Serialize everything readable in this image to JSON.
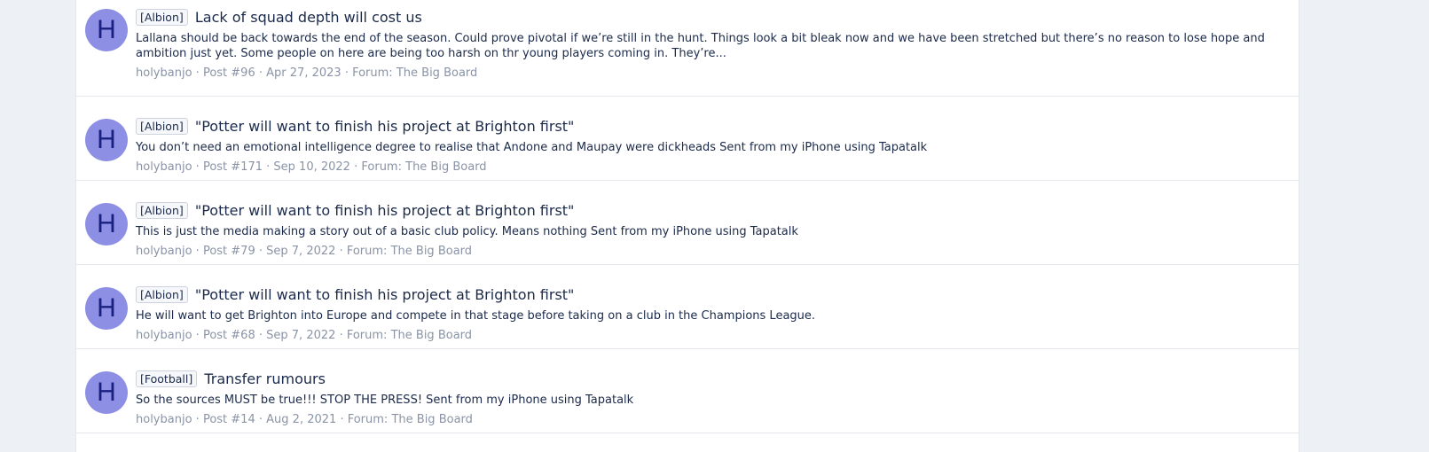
{
  "results": [
    {
      "avatar_letter": "H",
      "prefix": "[Albion]",
      "title": "Lack of squad depth will cost us",
      "snippet": "Lallana should be back towards the end of the season. Could prove pivotal if we’re still in the hunt. Things look a bit bleak now and we have been stretched but there’s no reason to lose hope and ambition just yet. Some people on here are being too harsh on thr young players coming in. They’re...",
      "author": "holybanjo",
      "post": "Post #96",
      "date": "Apr 27, 2023",
      "forum_label": "Forum:",
      "forum": "The Big Board"
    },
    {
      "avatar_letter": "H",
      "prefix": "[Albion]",
      "title": "\"Potter will want to finish his project at Brighton first\"",
      "snippet": "You don’t need an emotional intelligence degree to realise that Andone and Maupay were dickheads Sent from my iPhone using Tapatalk",
      "author": "holybanjo",
      "post": "Post #171",
      "date": "Sep 10, 2022",
      "forum_label": "Forum:",
      "forum": "The Big Board"
    },
    {
      "avatar_letter": "H",
      "prefix": "[Albion]",
      "title": "\"Potter will want to finish his project at Brighton first\"",
      "snippet": "This is just the media making a story out of a basic club policy. Means nothing Sent from my iPhone using Tapatalk",
      "author": "holybanjo",
      "post": "Post #79",
      "date": "Sep 7, 2022",
      "forum_label": "Forum:",
      "forum": "The Big Board"
    },
    {
      "avatar_letter": "H",
      "prefix": "[Albion]",
      "title": "\"Potter will want to finish his project at Brighton first\"",
      "snippet": "He will want to get Brighton into Europe and compete in that stage before taking on a club in the Champions League.",
      "author": "holybanjo",
      "post": "Post #68",
      "date": "Sep 7, 2022",
      "forum_label": "Forum:",
      "forum": "The Big Board"
    },
    {
      "avatar_letter": "H",
      "prefix": "[Football]",
      "title": "Transfer rumours",
      "snippet": "So the sources MUST be true!!! STOP THE PRESS! Sent from my iPhone using Tapatalk",
      "author": "holybanjo",
      "post": "Post #14",
      "date": "Aug 2, 2021",
      "forum_label": "Forum:",
      "forum": "The Big Board"
    }
  ],
  "colors": {
    "avatar_bg": "#8c8fe3",
    "avatar_text": "#1a2080",
    "title": "#1b2a4a",
    "meta": "#8a94a6",
    "page_bg": "#edf0f5"
  },
  "separator": "·"
}
